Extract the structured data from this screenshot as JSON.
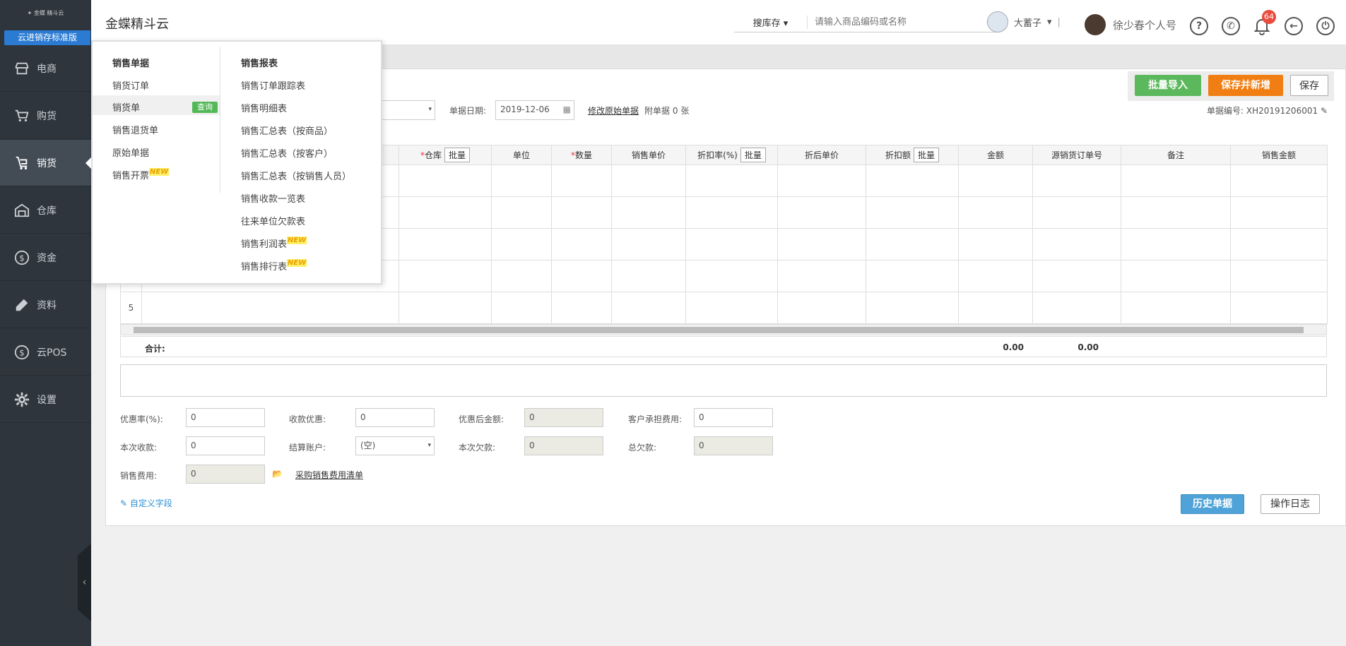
{
  "app": {
    "title": "金蝶精斗云",
    "edition": "云进销存标准版"
  },
  "sidebar": {
    "items": [
      {
        "label": "电商",
        "icon": "store-icon"
      },
      {
        "label": "购货",
        "icon": "cart-icon"
      },
      {
        "label": "销货",
        "icon": "trolley-icon"
      },
      {
        "label": "仓库",
        "icon": "warehouse-icon"
      },
      {
        "label": "资金",
        "icon": "dollar-icon"
      },
      {
        "label": "资料",
        "icon": "pencil-icon"
      },
      {
        "label": "云POS",
        "icon": "dollar-icon"
      },
      {
        "label": "设置",
        "icon": "gear-icon"
      }
    ]
  },
  "header": {
    "search_type": "搜库存",
    "search_placeholder": "请输入商品编码或名称",
    "store_name": "大蓄子",
    "user_name": "徐少春个人号",
    "notification_count": "64"
  },
  "toolbar": {
    "batch_import": "批量导入",
    "save_and_new": "保存并新增",
    "save": "保存"
  },
  "form": {
    "date_label": "单据日期:",
    "date_value": "2019-12-06",
    "modify_original": "修改原始单据",
    "attach_label": "附单据",
    "attach_count": "0",
    "attach_unit": "张",
    "doc_no_label": "单据编号:",
    "doc_no": "XH20191206001"
  },
  "table": {
    "columns": [
      "仓库",
      "单位",
      "数量",
      "销售单价",
      "折扣率(%)",
      "折后单价",
      "折扣额",
      "金额",
      "源销货订单号",
      "备注",
      "销售金额"
    ],
    "batch_label": "批量",
    "row5": "5",
    "sum_label": "合计:",
    "sum_discount": "0.00",
    "sum_amount": "0.00"
  },
  "footer": {
    "discount_rate_label": "优惠率(%):",
    "discount_rate": "0",
    "receipt_discount_label": "收款优惠:",
    "receipt_discount": "0",
    "after_discount_label": "优惠后金额:",
    "after_discount": "0",
    "customer_fee_label": "客户承担费用:",
    "customer_fee": "0",
    "this_receipt_label": "本次收款:",
    "this_receipt": "0",
    "account_label": "结算账户:",
    "account": "(空)",
    "this_debt_label": "本次欠款:",
    "this_debt": "0",
    "total_debt_label": "总欠款:",
    "total_debt": "0",
    "sales_fee_label": "销售费用:",
    "sales_fee": "0",
    "purchase_fee_link": "采购销售费用清单",
    "custom_fields": "自定义字段",
    "history": "历史单据",
    "log": "操作日志"
  },
  "dropdown": {
    "col1_title": "销售单据",
    "col1": [
      "销货订单",
      "销货单",
      "销售退货单",
      "原始单据",
      "销售开票"
    ],
    "query": "查询",
    "col2_title": "销售报表",
    "col2": [
      "销售订单跟踪表",
      "销售明细表",
      "销售汇总表（按商品）",
      "销售汇总表（按客户）",
      "销售汇总表（按销售人员）",
      "销售收款一览表",
      "往来单位欠款表",
      "销售利润表",
      "销售排行表"
    ],
    "new_tag": "NEW"
  },
  "colors": {
    "sidebar": "#2e353c",
    "green": "#5cb85c",
    "orange": "#f07e13",
    "blue": "#4fa3d8"
  }
}
